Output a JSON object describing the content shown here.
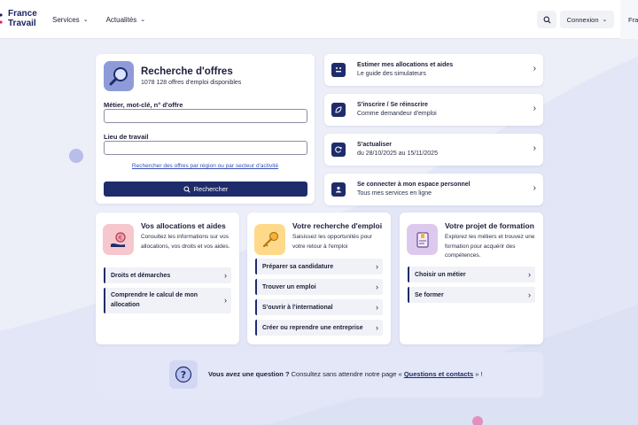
{
  "header": {
    "logo_line1": "France",
    "logo_line2": "Travail",
    "nav": [
      {
        "label": "Services"
      },
      {
        "label": "Actualités"
      }
    ],
    "login_label": "Connexion",
    "lang_label": "Fra"
  },
  "search": {
    "title": "Recherche d'offres",
    "subtitle": "1078 128 offres d'emploi disponibles",
    "keyword_label": "Métier, mot-clé, n° d'offre",
    "keyword_value": "",
    "location_label": "Lieu de travail",
    "location_value": "",
    "link": "Rechercher des offres par région ou par secteur d'activité",
    "button": "Rechercher"
  },
  "quick_links": [
    {
      "title": "Estimer mes allocations et aides",
      "subtitle": "Le guide des simulateurs",
      "icon": "simulator-icon"
    },
    {
      "title": "S'inscrire / Se réinscrire",
      "subtitle": "Comme demandeur d'emploi",
      "icon": "leaf-icon"
    },
    {
      "title": "S'actualiser",
      "subtitle": "du 28/10/2025 au 15/11/2025",
      "icon": "refresh-icon"
    },
    {
      "title": "Se connecter à mon espace personnel",
      "subtitle": "Tous mes services en ligne",
      "icon": "user-icon"
    }
  ],
  "cards": [
    {
      "title": "Vos allocations et aides",
      "desc": "Consultez les informations sur vos allocations, vos droits et vos aides.",
      "items": [
        "Droits et démarches",
        "Comprendre le calcul de mon allocation"
      ]
    },
    {
      "title": "Votre recherche d'emploi",
      "desc": "Saisissez les opportunités pour votre retour à l'emploi",
      "items": [
        "Préparer sa candidature",
        "Trouver un emploi",
        "S'ouvrir à l'international",
        "Créer ou reprendre une entreprise"
      ]
    },
    {
      "title": "Votre projet de formation",
      "desc": "Explorez les métiers et trouvez une formation pour acquérir des compétences.",
      "items": [
        "Choisir un métier",
        "Se former"
      ]
    }
  ],
  "faq": {
    "question": "Vous avez une question ?",
    "text": " Consultez sans attendre notre page « ",
    "link": "Questions et contacts",
    "end": " » !"
  },
  "colors": {
    "primary": "#1f2c6b",
    "background": "#eceef8",
    "link": "#3550b8"
  }
}
